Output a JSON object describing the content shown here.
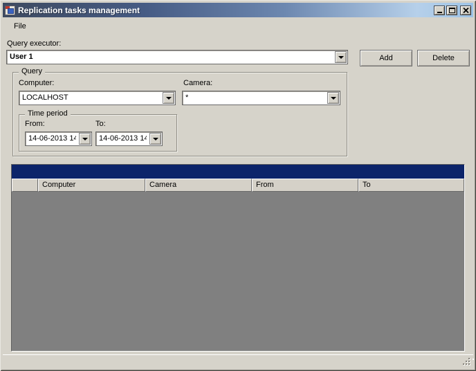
{
  "window": {
    "title": "Replication tasks management",
    "controls": {
      "minimize": "minimize",
      "maximize": "maximize",
      "close": "close"
    }
  },
  "menu": {
    "items": [
      {
        "label": "File"
      }
    ]
  },
  "query_executor": {
    "label": "Query executor:",
    "value": "User 1"
  },
  "toolbar": {
    "add_label": "Add",
    "delete_label": "Delete"
  },
  "query_group": {
    "title": "Query",
    "computer": {
      "label": "Computer:",
      "value": "LOCALHOST"
    },
    "camera": {
      "label": "Camera:",
      "value": "*"
    },
    "time_period": {
      "title": "Time period",
      "from": {
        "label": "From:",
        "value": "14-06-2013 14"
      },
      "to": {
        "label": "To:",
        "value": "14-06-2013 14"
      }
    }
  },
  "grid": {
    "columns": [
      "",
      "Computer",
      "Camera",
      "From",
      "To"
    ],
    "rows": [],
    "caption_text": ""
  },
  "colors": {
    "titlebar_gradient_start": "#3e4a60",
    "titlebar_gradient_end": "#9ec3e6",
    "form_background": "#d6d3ca",
    "grid_caption": "#0c246a",
    "grid_body": "#808080",
    "header_cell": "#d5d1c8"
  }
}
